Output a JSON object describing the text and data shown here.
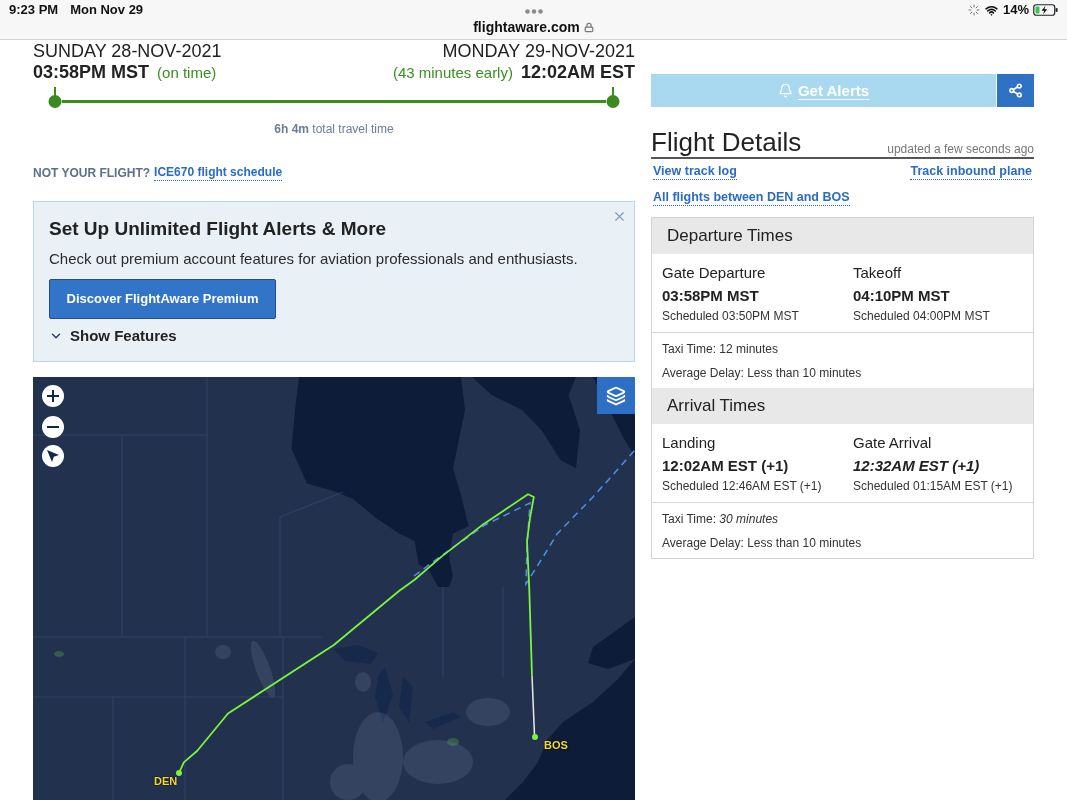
{
  "status_bar": {
    "time": "9:23 PM",
    "date": "Mon Nov 29",
    "url": "flightaware.com",
    "battery": "14%"
  },
  "flight_summary": {
    "departure": {
      "date": "SUNDAY 28-NOV-2021",
      "time": "03:58PM MST",
      "status": "(on time)"
    },
    "arrival": {
      "date": "MONDAY 29-NOV-2021",
      "time": "12:02AM EST",
      "status": "(43 minutes early)"
    },
    "travel_time": "**6h 4m** total travel time"
  },
  "not_your_flight": {
    "label": "NOT YOUR FLIGHT?",
    "link": "ICE670 flight schedule"
  },
  "promo": {
    "title": "Set Up Unlimited Flight Alerts & More",
    "description": "Check out premium account features for aviation professionals and enthusiasts.",
    "button": "Discover FlightAware Premium",
    "toggle": {
      "label": "Show Features",
      "expanded": false
    }
  },
  "map": {
    "airports": [
      {
        "code": "DEN"
      },
      {
        "code": "BOS"
      }
    ]
  },
  "alerts_bar": {
    "button": "Get Alerts"
  },
  "flight_details": {
    "title": "Flight Details",
    "updated": "updated a few seconds ago",
    "links": [
      "View track log",
      "Track inbound plane",
      "All flights between DEN and BOS"
    ],
    "sections": [
      {
        "title": "Departure Times",
        "times": [
          {
            "label": "Gate Departure",
            "value": "03:58PM MST",
            "scheduled": "Scheduled 03:50PM MST",
            "estimated": false
          },
          {
            "label": "Takeoff",
            "value": "04:10PM MST",
            "scheduled": "Scheduled 04:00PM MST",
            "estimated": false
          }
        ],
        "notes": [
          "Taxi Time: 12 minutes",
          "Average Delay: Less than 10 minutes"
        ]
      },
      {
        "title": "Arrival Times",
        "times": [
          {
            "label": "Landing",
            "value": "12:02AM EST (+1)",
            "scheduled": "Scheduled 12:46AM EST (+1)",
            "estimated": false
          },
          {
            "label": "Gate Arrival",
            "value": "12:32AM EST (+1)",
            "scheduled": "Scheduled 01:15AM EST (+1)",
            "estimated": true
          }
        ],
        "notes": [
          "Taxi Time: *30 minutes*",
          "Average Delay: Less than 10 minutes"
        ]
      }
    ]
  }
}
